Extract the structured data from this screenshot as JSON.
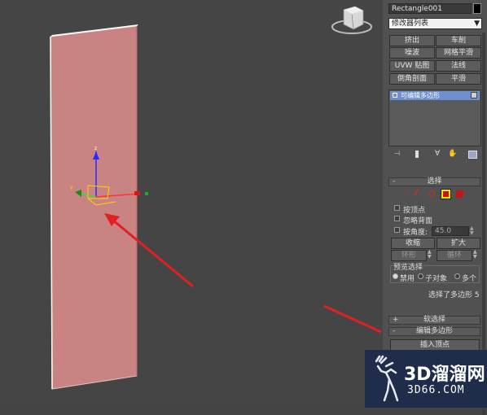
{
  "object": {
    "name": "Rectangle001",
    "color": "#000000"
  },
  "modifier_list": {
    "label": "修改器列表"
  },
  "tool_buttons": [
    "挤出",
    "车削",
    "噪波",
    "网格平滑",
    "UVW 贴图",
    "法线",
    "倒角剖面",
    "平滑"
  ],
  "stack": {
    "item": "可编辑多边形"
  },
  "selection": {
    "title": "选择",
    "sign": "-",
    "by_vertex": "按顶点",
    "ignore_backfacing": "忽略背面",
    "by_angle": "按角度:",
    "angle_value": "45.0",
    "shrink": "收缩",
    "grow": "扩大",
    "ring": "环形",
    "loop": "循环",
    "preview_title": "预览选择",
    "preview_options": [
      "禁用",
      "子对象",
      "多个"
    ],
    "status": "选择了多边形 5"
  },
  "soft_selection": {
    "title": "软选择",
    "sign": "+"
  },
  "edit_poly": {
    "title": "编辑多边形",
    "sign": "-"
  },
  "insert_vertex": "插入顶点",
  "viewport": {
    "plane_color": "#d98a8a",
    "arrow_color": "#e12020"
  },
  "watermark": {
    "brand": "3D溜溜网",
    "url": "3D66.COM"
  }
}
